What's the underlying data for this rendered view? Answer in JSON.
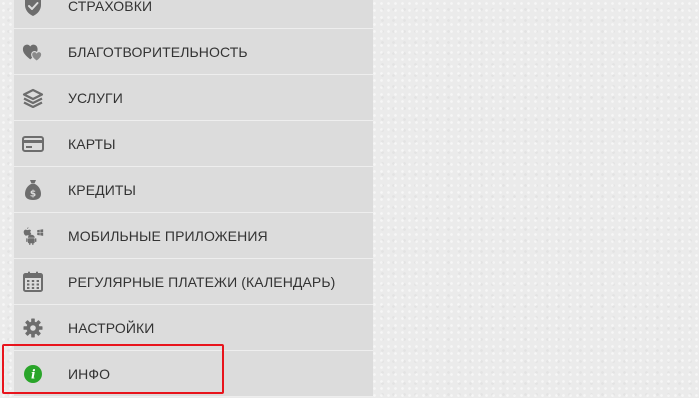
{
  "menu": {
    "items": [
      {
        "label": "СТРАХОВКИ",
        "icon": "shield-check-icon"
      },
      {
        "label": "БЛАГОТВОРИТЕЛЬНОСТЬ",
        "icon": "hearts-icon"
      },
      {
        "label": "УСЛУГИ",
        "icon": "layers-icon"
      },
      {
        "label": "КАРТЫ",
        "icon": "credit-card-icon"
      },
      {
        "label": "КРЕДИТЫ",
        "icon": "money-bag-icon"
      },
      {
        "label": "МОБИЛЬНЫЕ ПРИЛОЖЕНИЯ",
        "icon": "mobile-platforms-icon"
      },
      {
        "label": "РЕГУЛЯРНЫЕ ПЛАТЕЖИ (КАЛЕНДАРЬ)",
        "icon": "calendar-icon"
      },
      {
        "label": "НАСТРОЙКИ",
        "icon": "gear-icon"
      },
      {
        "label": "ИНФО",
        "icon": "info-icon"
      }
    ]
  },
  "colors": {
    "icon_gray": "#6d6d6d",
    "info_green": "#2aa52a",
    "highlight_red": "#e8141c",
    "menu_bg": "#dcdcdc"
  }
}
